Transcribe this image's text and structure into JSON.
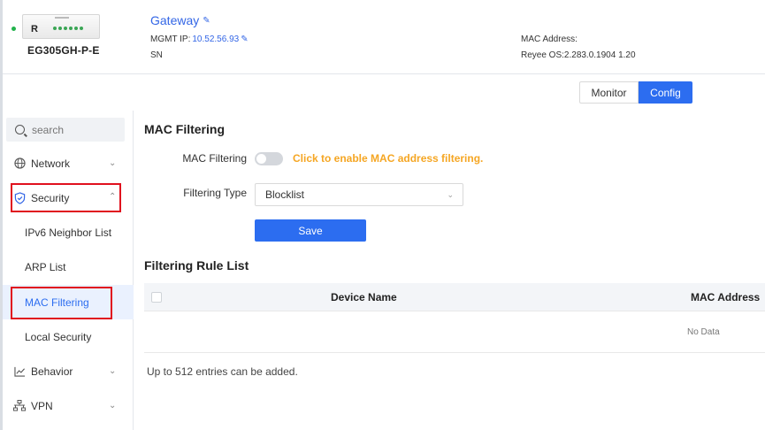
{
  "device": {
    "model": "EG305GH-P-E",
    "logo_letter": "R",
    "name": "Gateway",
    "mgmt_label": "MGMT IP:",
    "mgmt_ip": "10.52.56.93",
    "sn_label": "SN",
    "mac_label": "MAC Address:",
    "os_label": "Reyee OS:2.283.0.1904 1.20"
  },
  "tabs": [
    {
      "label": "Monitor",
      "active": false
    },
    {
      "label": "Config",
      "active": true
    }
  ],
  "sidebar": {
    "search_placeholder": "search",
    "items": [
      {
        "label": "Network",
        "icon": "globe-icon",
        "expanded": false
      },
      {
        "label": "Security",
        "icon": "shield-icon",
        "expanded": true,
        "highlighted": true
      },
      {
        "label": "IPv6 Neighbor List"
      },
      {
        "label": "ARP List"
      },
      {
        "label": "MAC Filtering",
        "active": true,
        "highlighted": true
      },
      {
        "label": "Local Security"
      },
      {
        "label": "Behavior",
        "icon": "chart-line-icon",
        "expanded": false
      },
      {
        "label": "VPN",
        "icon": "network-icon",
        "expanded": false
      }
    ]
  },
  "main": {
    "title": "MAC Filtering",
    "filter_label": "MAC Filtering",
    "filter_enabled": false,
    "hint": "Click to enable MAC address filtering.",
    "type_label": "Filtering Type",
    "type_value": "Blocklist",
    "save_label": "Save",
    "list_title": "Filtering Rule List",
    "columns": [
      "Device Name",
      "MAC Address"
    ],
    "no_data": "No Data",
    "note": "Up to 512 entries can be added."
  },
  "colors": {
    "accent": "#2c6df0",
    "link": "#3366e6",
    "hint": "#f5a623",
    "highlight_box": "#e0101e",
    "status_online": "#22b24c"
  }
}
